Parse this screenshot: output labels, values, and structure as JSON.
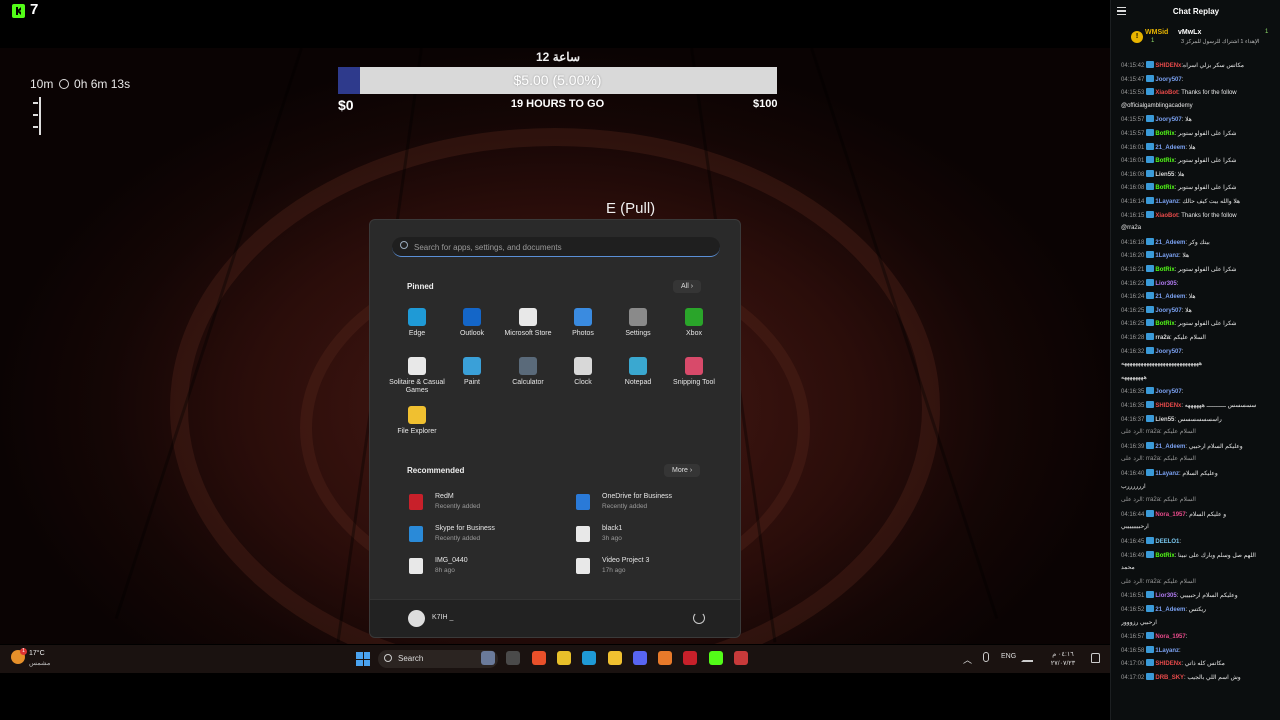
{
  "stream": {
    "viewer_count": "7",
    "timer": {
      "left": "10m",
      "right": "0h 6m 13s"
    },
    "goal": {
      "title": "ساعة 12",
      "amount_label": "$5.00 (5.00%)",
      "progress_fraction": 0.05,
      "start_label": "$0",
      "subtitle": "19 HOURS TO GO",
      "end_label": "$100"
    },
    "pull_hint": "E (Pull)"
  },
  "start_menu": {
    "search_placeholder": "Search for apps, settings, and documents",
    "pinned_title": "Pinned",
    "all_button": "All  ›",
    "pinned_apps": [
      {
        "label": "Edge",
        "icon": "edge-icon",
        "color": "#1f9ad6"
      },
      {
        "label": "Outlook",
        "icon": "outlook-icon",
        "color": "#1466c8"
      },
      {
        "label": "Microsoft Store",
        "icon": "store-icon",
        "color": "#e8e8e8"
      },
      {
        "label": "Photos",
        "icon": "photos-icon",
        "color": "#3a8be0"
      },
      {
        "label": "Settings",
        "icon": "settings-icon",
        "color": "#8a8a8a"
      },
      {
        "label": "Xbox",
        "icon": "xbox-icon",
        "color": "#2aa52a"
      },
      {
        "label": "Solitaire & Casual Games",
        "icon": "solitaire-icon",
        "color": "#e8e8e8"
      },
      {
        "label": "Paint",
        "icon": "paint-icon",
        "color": "#3aa0d8"
      },
      {
        "label": "Calculator",
        "icon": "calculator-icon",
        "color": "#5a6a7a"
      },
      {
        "label": "Clock",
        "icon": "clock-icon",
        "color": "#d8d8d8"
      },
      {
        "label": "Notepad",
        "icon": "notepad-icon",
        "color": "#3aa8d0"
      },
      {
        "label": "Snipping Tool",
        "icon": "snipping-tool-icon",
        "color": "#d84a6a"
      },
      {
        "label": "File Explorer",
        "icon": "file-explorer-icon",
        "color": "#f0c030"
      }
    ],
    "recommended_title": "Recommended",
    "more_button": "More  ›",
    "recommended": [
      {
        "name": "RedM",
        "sub": "Recently added",
        "icon": "redm-icon",
        "color": "#c8202a"
      },
      {
        "name": "OneDrive for Business",
        "sub": "Recently added",
        "icon": "onedrive-icon",
        "color": "#2a7ad8"
      },
      {
        "name": "Skype for Business",
        "sub": "Recently added",
        "icon": "skype-icon",
        "color": "#2a8ad8"
      },
      {
        "name": "black1",
        "sub": "3h ago",
        "icon": "document-icon",
        "color": "#e8e8e8"
      },
      {
        "name": "IMG_0440",
        "sub": "8h ago",
        "icon": "image-file-icon",
        "color": "#e8e8e8"
      },
      {
        "name": "Video Project 3",
        "sub": "17h ago",
        "icon": "video-file-icon",
        "color": "#e8e8e8"
      }
    ],
    "user_name": "K7IH _"
  },
  "taskbar": {
    "weather_temp": "17°C",
    "weather_desc": "مشمس",
    "weather_badge": "1",
    "search_label": "Search",
    "apps": [
      {
        "icon": "task-view-icon",
        "color": "#6a7a9a"
      },
      {
        "icon": "widgets-icon",
        "color": "#4a4a4a"
      },
      {
        "icon": "brave-icon",
        "color": "#e8502a"
      },
      {
        "icon": "chrome-icon",
        "color": "#e8c02a"
      },
      {
        "icon": "edge-icon",
        "color": "#1f9ad6"
      },
      {
        "icon": "file-explorer-icon",
        "color": "#f0c030"
      },
      {
        "icon": "discord-icon",
        "color": "#5865f2"
      },
      {
        "icon": "app-icon",
        "color": "#e87a2a"
      },
      {
        "icon": "redm-icon",
        "color": "#c8202a"
      },
      {
        "icon": "kick-icon",
        "color": "#53fc18"
      },
      {
        "icon": "app-icon",
        "color": "#c83a3a"
      }
    ],
    "language": "ENG",
    "time": "٠٤:١٦ م",
    "date": "٢٧/٠٧/٢٣"
  },
  "chat": {
    "title": "Chat Replay",
    "pinned": {
      "user1": "WMSid",
      "user2": "vMwLx",
      "count1": "1",
      "count2": "1",
      "message": "الإهداء 1 اشتراك للرسول للمركز 3"
    },
    "messages": [
      {
        "time": "04:15:42",
        "user": "SHIDENx",
        "color": "#e84a4a",
        "text": ":مكاتس سكر بزلي اسراه"
      },
      {
        "time": "04:15:47",
        "user": "Joory507",
        "color": "#7aa0f0",
        "text": ":"
      },
      {
        "time": "04:15:53",
        "user": "XiaoBot",
        "color": "#e84a4a",
        "text": ": Thanks for the follow"
      },
      {
        "time": "",
        "user": "",
        "color": "#e8e8e8",
        "text": "@officialgamblingacademy"
      },
      {
        "time": "04:15:57",
        "user": "Joory507",
        "color": "#7aa0f0",
        "text": ": هلا"
      },
      {
        "time": "04:15:57",
        "user": "BotRix",
        "color": "#53fc18",
        "text": ": شكرا على الفولو ستوبر"
      },
      {
        "time": "04:16:01",
        "user": "21_Adeem",
        "color": "#7aa0f0",
        "text": ": هلا"
      },
      {
        "time": "04:16:01",
        "user": "BotRix",
        "color": "#53fc18",
        "text": ": شكرا على الفولو ستوبر"
      },
      {
        "time": "04:16:08",
        "user": "Lien55",
        "color": "#d8d8d8",
        "text": ": هلا"
      },
      {
        "time": "04:16:08",
        "user": "BotRix",
        "color": "#53fc18",
        "text": ": شكرا على الفولو ستوبر"
      },
      {
        "time": "04:16:14",
        "user": "1Layanz",
        "color": "#7aa0f0",
        "text": ": هلا والله بيت كيف حالك"
      },
      {
        "time": "04:16:15",
        "user": "XiaoBot",
        "color": "#e84a4a",
        "text": ": Thanks for the follow"
      },
      {
        "time": "",
        "user": "",
        "color": "#e8e8e8",
        "text": "@rra2a"
      },
      {
        "time": "04:16:18",
        "user": "21_Adeem",
        "color": "#7aa0f0",
        "text": ": بيتك وكر"
      },
      {
        "time": "04:16:20",
        "user": "1Layanz",
        "color": "#7aa0f0",
        "text": ": هلا"
      },
      {
        "time": "04:16:21",
        "user": "BotRix",
        "color": "#53fc18",
        "text": ": شكرا على الفولو ستوبر"
      },
      {
        "time": "04:16:22",
        "user": "Lior305",
        "color": "#b07af0",
        "text": ":"
      },
      {
        "time": "04:16:24",
        "user": "21_Adeem",
        "color": "#7aa0f0",
        "text": ": هلا"
      },
      {
        "time": "04:16:25",
        "user": "Joory507",
        "color": "#7aa0f0",
        "text": ": هلا"
      },
      {
        "time": "04:16:25",
        "user": "BotRix",
        "color": "#53fc18",
        "text": ": شكرا على الفولو ستوبر"
      },
      {
        "time": "04:16:28",
        "user": "rra2a",
        "color": "#d8d8d8",
        "text": ": السلام عليكم"
      },
      {
        "time": "04:16:32",
        "user": "Joory507",
        "color": "#7aa0f0",
        "text": ":"
      },
      {
        "time": "",
        "user": "",
        "color": "#e8e8e8",
        "text": "ههههههههههههههههههههههههههههه"
      },
      {
        "time": "",
        "user": "",
        "color": "#e8e8e8",
        "text": "ههههههههه"
      },
      {
        "time": "04:16:35",
        "user": "Joory507",
        "color": "#7aa0f0",
        "text": ":"
      },
      {
        "time": "04:16:35",
        "user": "SHIDENx",
        "color": "#e84a4a",
        "text": ": سسسسس ـــــــــــ ههههههه"
      },
      {
        "time": "04:16:37",
        "user": "Lien55",
        "color": "#d8d8d8",
        "text": ": راسسسسسسس"
      },
      {
        "time": "",
        "user": "",
        "color": "#9a9a9a",
        "text": "الرد على: rra2a: السلام عليكم"
      },
      {
        "time": "04:16:39",
        "user": "21_Adeem",
        "color": "#7aa0f0",
        "text": ": وعليكم السلام ارحبيي"
      },
      {
        "time": "",
        "user": "",
        "color": "#9a9a9a",
        "text": "الرد على: rra2a: السلام عليكم"
      },
      {
        "time": "04:16:40",
        "user": "1Layanz",
        "color": "#7aa0f0",
        "text": ": وعليكم السلام"
      },
      {
        "time": "",
        "user": "",
        "color": "#e8e8e8",
        "text": "اررررررب"
      },
      {
        "time": "",
        "user": "",
        "color": "#9a9a9a",
        "text": "الرد على: rra2a: السلام عليكم"
      },
      {
        "time": "04:16:44",
        "user": "Nora_1957",
        "color": "#e84a8a",
        "text": ": و عليكم السلام"
      },
      {
        "time": "",
        "user": "",
        "color": "#e8e8e8",
        "text": "ارحبيييييييي"
      },
      {
        "time": "04:16:45",
        "user": "DEELO1",
        "color": "#7ac8f0",
        "text": ":"
      },
      {
        "time": "04:16:49",
        "user": "BotRix",
        "color": "#53fc18",
        "text": ": اللهم صل وسلم وبارك على نبينا"
      },
      {
        "time": "",
        "user": "",
        "color": "#e8e8e8",
        "text": "محمد"
      },
      {
        "time": "",
        "user": "",
        "color": "#9a9a9a",
        "text": "الرد على: rra2a: السلام عليكم"
      },
      {
        "time": "04:16:51",
        "user": "Lior305",
        "color": "#b07af0",
        "text": ": وعليكم السلام ارحبيييي"
      },
      {
        "time": "04:16:52",
        "user": "21_Adeem",
        "color": "#7aa0f0",
        "text": ": ريكتس"
      },
      {
        "time": "",
        "user": "",
        "color": "#e8e8e8",
        "text": "ارحبيي رزووور"
      },
      {
        "time": "04:16:57",
        "user": "Nora_1957",
        "color": "#e84a8a",
        "text": ":"
      },
      {
        "time": "04:16:58",
        "user": "1Layanz",
        "color": "#7aa0f0",
        "text": ":"
      },
      {
        "time": "04:17:00",
        "user": "SHIDENx",
        "color": "#e84a4a",
        "text": ": مكاتس كله ذاتي"
      },
      {
        "time": "04:17:02",
        "user": "DRB_SKY",
        "color": "#e84a4a",
        "text": ": وش اسم اللي بالجيب"
      }
    ]
  }
}
